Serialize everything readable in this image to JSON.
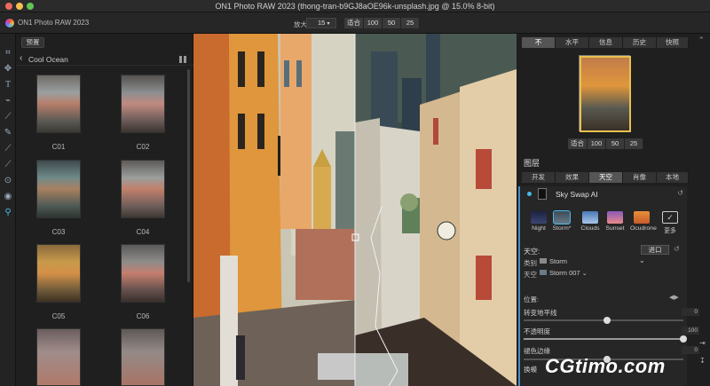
{
  "window": {
    "title": "thong-tran-b9GJ8aOE96k-unsplash.jpg @ 15.0% 8-bit)",
    "app_name": "ON1 Photo RAW 2023",
    "window_title_prefix": "ON1 Photo RAW 2023 ("
  },
  "toolbar": {
    "zoom_label": "放大",
    "zoom_value": "15",
    "fit_label": "适合",
    "z100": "100",
    "z50": "50",
    "z25": "25"
  },
  "browser": {
    "preset_button": "预置",
    "category": "Cool Ocean",
    "thumbnails": [
      "C01",
      "C02",
      "C03",
      "C04",
      "C05",
      "C06"
    ]
  },
  "right": {
    "tabs": [
      "不",
      "水平",
      "信息",
      "历史",
      "快照"
    ],
    "nav_fit": "适合",
    "nav_100": "100",
    "nav_50": "50",
    "nav_25": "25",
    "layers_label": "图层",
    "module_tabs": [
      "开发",
      "效果",
      "天空",
      "肖像",
      "本地"
    ],
    "filter_title": "Sky Swap AI",
    "sky_options": [
      "Night",
      "Storm*",
      "Clouds",
      "Sunset",
      "Ocudrone",
      "更多"
    ],
    "sky_label": "天空:",
    "import_button": "进口",
    "category_label": "类别",
    "category_value": "Storm",
    "sky_item_label": "天空",
    "sky_item_value": "Storm 007",
    "position_label": "位置:",
    "horizon_label": "转变地平线",
    "horizon_value": "0",
    "opacity_label": "不透明度",
    "opacity_value": "100",
    "fade_label": "褪色边缘",
    "fade_value": "0",
    "next_label": "换蟆"
  },
  "watermark": "CGtimo.com",
  "colors": {
    "accent": "#4a8fc8",
    "panel": "#1f1f1f"
  }
}
